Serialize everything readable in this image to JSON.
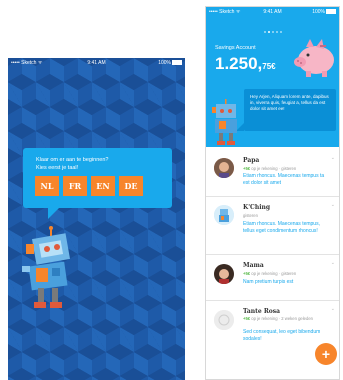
{
  "screen1": {
    "status": {
      "carrier": "••••• Sketch ᯤ",
      "time": "9:41 AM",
      "battery": "100%"
    },
    "prompt_line1": "Klaar om er aan te beginnen?",
    "prompt_line2": "Kies eerst je taal!",
    "languages": [
      "NL",
      "FR",
      "EN",
      "DE"
    ]
  },
  "screen2": {
    "status": {
      "carrier": "••••• Sketch ᯤ",
      "time": "9:41 AM",
      "battery": "100%"
    },
    "savings_label": "Savings Account",
    "amount_main": "1.250,",
    "amount_cents": "75€",
    "robot_message": "Hey Arjen, Aliquam lorem ante, dapibus in, viverra quis, feugiat a, tellus da est dolor sit amet ee!",
    "fab_label": "+",
    "contacts": [
      {
        "name": "Papa",
        "amount": "+5€",
        "meta": "op je rekening · gisteren",
        "message": "Etiam rhoncus. Maecenas tempus ta est dolor sit amet"
      },
      {
        "name": "K'Ching",
        "amount": "",
        "meta": "gisteren",
        "message": "Etiam rhoncus. Maecenas tempus, tellus eget condimentum rhoncus!"
      },
      {
        "name": "Mama",
        "amount": "+5€",
        "meta": "op je rekening · gisteren",
        "message": "Nam pretium turpis est"
      },
      {
        "name": "Tante Rosa",
        "amount": "+5€",
        "meta": "op je rekening · 2 weken geleden",
        "message": "Sed consequat, leo eget bibendum sodales!"
      }
    ]
  },
  "colors": {
    "accent": "#19a9ec",
    "orange": "#f7852b",
    "dark_blue": "#1e5aa8",
    "green": "#56b947"
  }
}
